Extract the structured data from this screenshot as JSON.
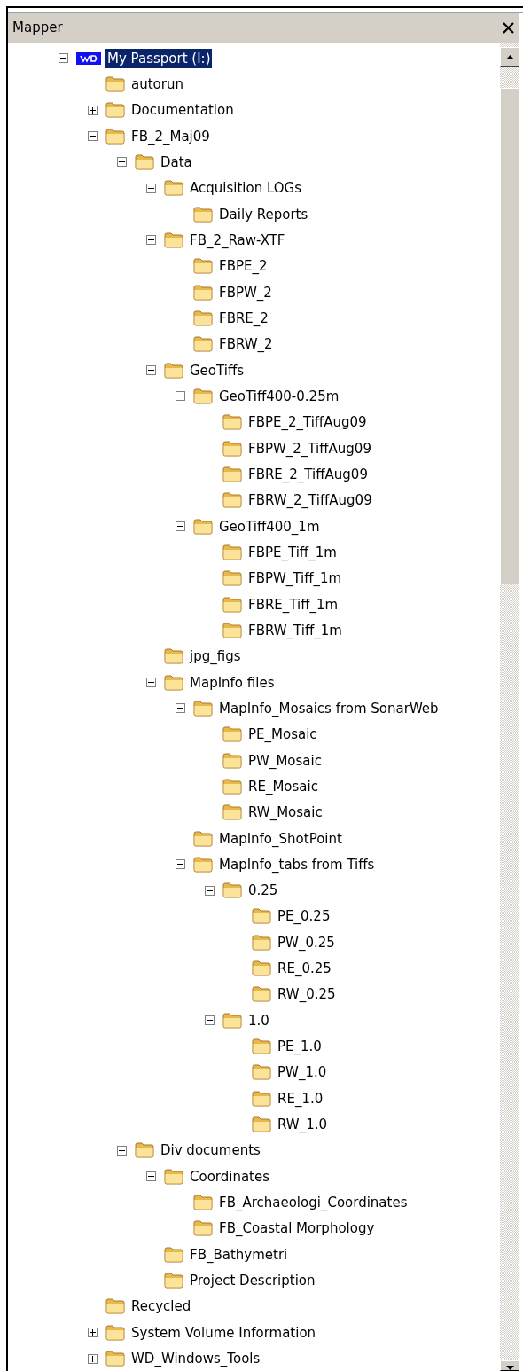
{
  "panel": {
    "title": "Mapper"
  },
  "tree": [
    {
      "label": "My Passport (I:)",
      "kind": "drive",
      "expanded": true,
      "selected": true,
      "children": [
        {
          "label": "autorun",
          "kind": "folder",
          "selected": false
        },
        {
          "label": "Documentation",
          "kind": "folder",
          "expanded": false,
          "selected": false
        },
        {
          "label": "FB_2_Maj09",
          "kind": "folder",
          "expanded": true,
          "selected": false,
          "children": [
            {
              "label": "Data",
              "kind": "folder",
              "expanded": true,
              "selected": false,
              "children": [
                {
                  "label": "Acquisition LOGs",
                  "kind": "folder",
                  "expanded": true,
                  "selected": false,
                  "children": [
                    {
                      "label": "Daily Reports",
                      "kind": "folder",
                      "selected": false
                    }
                  ]
                },
                {
                  "label": "FB_2_Raw-XTF",
                  "kind": "folder",
                  "expanded": true,
                  "selected": false,
                  "children": [
                    {
                      "label": "FBPE_2",
                      "kind": "folder",
                      "selected": false
                    },
                    {
                      "label": "FBPW_2",
                      "kind": "folder",
                      "selected": false
                    },
                    {
                      "label": "FBRE_2",
                      "kind": "folder",
                      "selected": false
                    },
                    {
                      "label": "FBRW_2",
                      "kind": "folder",
                      "selected": false
                    }
                  ]
                },
                {
                  "label": "GeoTiffs",
                  "kind": "folder",
                  "expanded": true,
                  "selected": false,
                  "children": [
                    {
                      "label": "GeoTiff400-0.25m",
                      "kind": "folder",
                      "expanded": true,
                      "selected": false,
                      "children": [
                        {
                          "label": "FBPE_2_TiffAug09",
                          "kind": "folder",
                          "selected": false
                        },
                        {
                          "label": "FBPW_2_TiffAug09",
                          "kind": "folder",
                          "selected": false
                        },
                        {
                          "label": "FBRE_2_TiffAug09",
                          "kind": "folder",
                          "selected": false
                        },
                        {
                          "label": "FBRW_2_TiffAug09",
                          "kind": "folder",
                          "selected": false
                        }
                      ]
                    },
                    {
                      "label": "GeoTiff400_1m",
                      "kind": "folder",
                      "expanded": true,
                      "selected": false,
                      "children": [
                        {
                          "label": "FBPE_Tiff_1m",
                          "kind": "folder",
                          "selected": false
                        },
                        {
                          "label": "FBPW_Tiff_1m",
                          "kind": "folder",
                          "selected": false
                        },
                        {
                          "label": "FBRE_Tiff_1m",
                          "kind": "folder",
                          "selected": false
                        },
                        {
                          "label": "FBRW_Tiff_1m",
                          "kind": "folder",
                          "selected": false
                        }
                      ]
                    }
                  ]
                },
                {
                  "label": "jpg_figs",
                  "kind": "folder",
                  "selected": false
                },
                {
                  "label": "MapInfo files",
                  "kind": "folder",
                  "expanded": true,
                  "selected": false,
                  "children": [
                    {
                      "label": "MapInfo_Mosaics from SonarWeb",
                      "kind": "folder",
                      "expanded": true,
                      "selected": false,
                      "children": [
                        {
                          "label": "PE_Mosaic",
                          "kind": "folder",
                          "selected": false
                        },
                        {
                          "label": "PW_Mosaic",
                          "kind": "folder",
                          "selected": false
                        },
                        {
                          "label": "RE_Mosaic",
                          "kind": "folder",
                          "selected": false
                        },
                        {
                          "label": "RW_Mosaic",
                          "kind": "folder",
                          "selected": false
                        }
                      ]
                    },
                    {
                      "label": "MapInfo_ShotPoint",
                      "kind": "folder",
                      "selected": false
                    },
                    {
                      "label": "MapInfo_tabs from Tiffs",
                      "kind": "folder",
                      "expanded": true,
                      "selected": false,
                      "children": [
                        {
                          "label": "0.25",
                          "kind": "folder",
                          "expanded": true,
                          "selected": false,
                          "children": [
                            {
                              "label": "PE_0.25",
                              "kind": "folder",
                              "selected": false
                            },
                            {
                              "label": "PW_0.25",
                              "kind": "folder",
                              "selected": false
                            },
                            {
                              "label": "RE_0.25",
                              "kind": "folder",
                              "selected": false
                            },
                            {
                              "label": "RW_0.25",
                              "kind": "folder",
                              "selected": false
                            }
                          ]
                        },
                        {
                          "label": "1.0",
                          "kind": "folder",
                          "expanded": true,
                          "selected": false,
                          "children": [
                            {
                              "label": "PE_1.0",
                              "kind": "folder",
                              "selected": false
                            },
                            {
                              "label": "PW_1.0",
                              "kind": "folder",
                              "selected": false
                            },
                            {
                              "label": "RE_1.0",
                              "kind": "folder",
                              "selected": false
                            },
                            {
                              "label": "RW_1.0",
                              "kind": "folder",
                              "selected": false
                            }
                          ]
                        }
                      ]
                    }
                  ]
                }
              ]
            },
            {
              "label": "Div documents",
              "kind": "folder",
              "expanded": true,
              "selected": false,
              "children": [
                {
                  "label": "Coordinates",
                  "kind": "folder",
                  "expanded": true,
                  "selected": false,
                  "children": [
                    {
                      "label": "FB_Archaeologi_Coordinates",
                      "kind": "folder",
                      "selected": false
                    },
                    {
                      "label": "FB_Coastal Morphology",
                      "kind": "folder",
                      "selected": false
                    }
                  ]
                },
                {
                  "label": "FB_Bathymetri",
                  "kind": "folder",
                  "selected": false
                },
                {
                  "label": "Project Description",
                  "kind": "folder",
                  "selected": false
                }
              ]
            }
          ]
        },
        {
          "label": "Recycled",
          "kind": "folder",
          "selected": false
        },
        {
          "label": "System Volume Information",
          "kind": "folder",
          "expanded": false,
          "selected": false
        },
        {
          "label": "WD_Windows_Tools",
          "kind": "folder",
          "expanded": false,
          "selected": false
        }
      ]
    }
  ]
}
